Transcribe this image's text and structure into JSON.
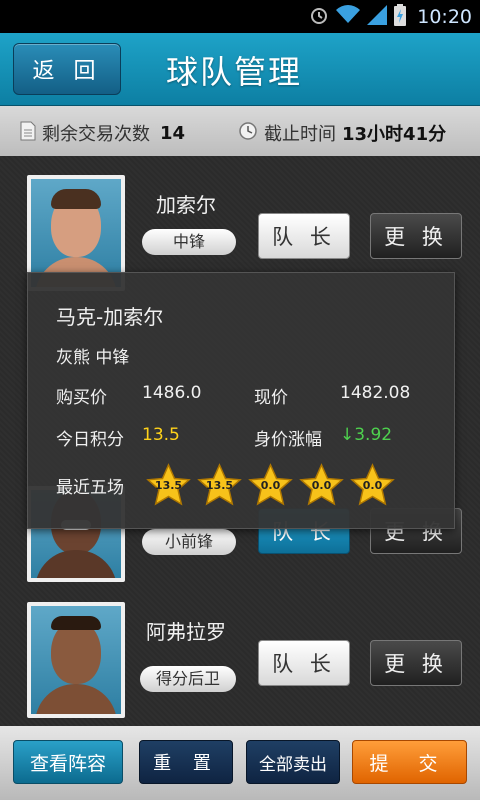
{
  "status_bar": {
    "time": "10:20"
  },
  "header": {
    "back_label": "返 回",
    "title": "球队管理"
  },
  "info": {
    "trades_label": "剩余交易次数",
    "trades_value": "14",
    "deadline_label": "截止时间",
    "deadline_value": "13小时41分"
  },
  "players": [
    {
      "name": "加索尔",
      "position": "中锋",
      "captain_label": "队 长",
      "swap_label": "更 换"
    },
    {
      "name": "",
      "position": "小前锋",
      "captain_label": "队 长",
      "swap_label": "更 换"
    },
    {
      "name": "阿弗拉罗",
      "position": "得分后卫",
      "captain_label": "队 长",
      "swap_label": "更 换"
    }
  ],
  "popup": {
    "full_name": "马克-加索尔",
    "team_position": "灰熊  中锋",
    "buy_price_label": "购买价",
    "buy_price": "1486.0",
    "current_price_label": "现价",
    "current_price": "1482.08",
    "today_score_label": "今日积分",
    "today_score": "13.5",
    "change_label": "身价涨幅",
    "change_value": "↓3.92",
    "recent_label": "最近五场",
    "recent_scores": [
      "13.5",
      "13.5",
      "0.0",
      "0.0",
      "0.0"
    ]
  },
  "bottom": {
    "view_label": "查看阵容",
    "reset_label": "重 置",
    "sell_all_label": "全部卖出",
    "submit_label": "提 交"
  },
  "colors": {
    "accent": "#1ea3c8",
    "submit": "#f07a10",
    "score": "#ffd21a",
    "change": "#4ed14e"
  }
}
